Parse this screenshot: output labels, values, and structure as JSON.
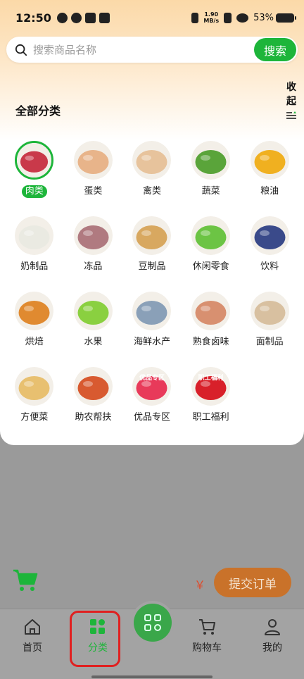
{
  "status_bar": {
    "time": "12:50",
    "net_speed_value": "1.90",
    "net_speed_unit": "MB/s",
    "battery": "53%"
  },
  "search": {
    "placeholder": "搜索商品名称",
    "button_label": "搜索"
  },
  "section": {
    "title": "全部分类",
    "collapse_label_1": "收",
    "collapse_label_2": "起"
  },
  "categories": [
    {
      "label": "肉类",
      "active": true,
      "icon": "meat-icon",
      "color": "#c9394a"
    },
    {
      "label": "蛋类",
      "active": false,
      "icon": "egg-icon",
      "color": "#e8b48a"
    },
    {
      "label": "禽类",
      "active": false,
      "icon": "poultry-icon",
      "color": "#e7c39c"
    },
    {
      "label": "蔬菜",
      "active": false,
      "icon": "vegetable-icon",
      "color": "#5aa43a"
    },
    {
      "label": "粮油",
      "active": false,
      "icon": "grain-oil-icon",
      "color": "#f0b020"
    },
    {
      "label": "奶制品",
      "active": false,
      "icon": "dairy-icon",
      "color": "#eaeae2"
    },
    {
      "label": "冻品",
      "active": false,
      "icon": "frozen-icon",
      "color": "#b07a80"
    },
    {
      "label": "豆制品",
      "active": false,
      "icon": "soy-icon",
      "color": "#d8a860"
    },
    {
      "label": "休闲零食",
      "active": false,
      "icon": "snack-icon",
      "color": "#6cc444"
    },
    {
      "label": "饮料",
      "active": false,
      "icon": "drink-icon",
      "color": "#3a4a8a"
    },
    {
      "label": "烘焙",
      "active": false,
      "icon": "bakery-icon",
      "color": "#e08a30"
    },
    {
      "label": "水果",
      "active": false,
      "icon": "fruit-icon",
      "color": "#8ad040"
    },
    {
      "label": "海鲜水产",
      "active": false,
      "icon": "seafood-icon",
      "color": "#8aa0b8"
    },
    {
      "label": "熟食卤味",
      "active": false,
      "icon": "deli-icon",
      "color": "#d89070"
    },
    {
      "label": "面制品",
      "active": false,
      "icon": "noodle-icon",
      "color": "#d8c0a0"
    },
    {
      "label": "方便菜",
      "active": false,
      "icon": "convenience-food-icon",
      "color": "#e8c070"
    },
    {
      "label": "助农帮扶",
      "active": false,
      "icon": "farm-aid-icon",
      "color": "#d85a30"
    },
    {
      "label": "优品专区",
      "active": false,
      "icon": "premium-zone-icon",
      "color": "#e83a5a",
      "badge": "优品专区"
    },
    {
      "label": "职工福利",
      "active": false,
      "icon": "staff-welfare-icon",
      "color": "#d8202a",
      "badge": "职工福利"
    }
  ],
  "cart": {
    "currency": "￥",
    "submit_label": "提交订单"
  },
  "tabs": [
    {
      "label": "首页",
      "icon": "home-icon"
    },
    {
      "label": "分类",
      "icon": "category-icon",
      "active": true
    },
    {
      "label": "购物车",
      "icon": "cart-icon"
    },
    {
      "label": "我的",
      "icon": "profile-icon"
    }
  ],
  "colors": {
    "accent": "#1db53a",
    "submit": "#c9722a",
    "highlight": "#e02020"
  }
}
